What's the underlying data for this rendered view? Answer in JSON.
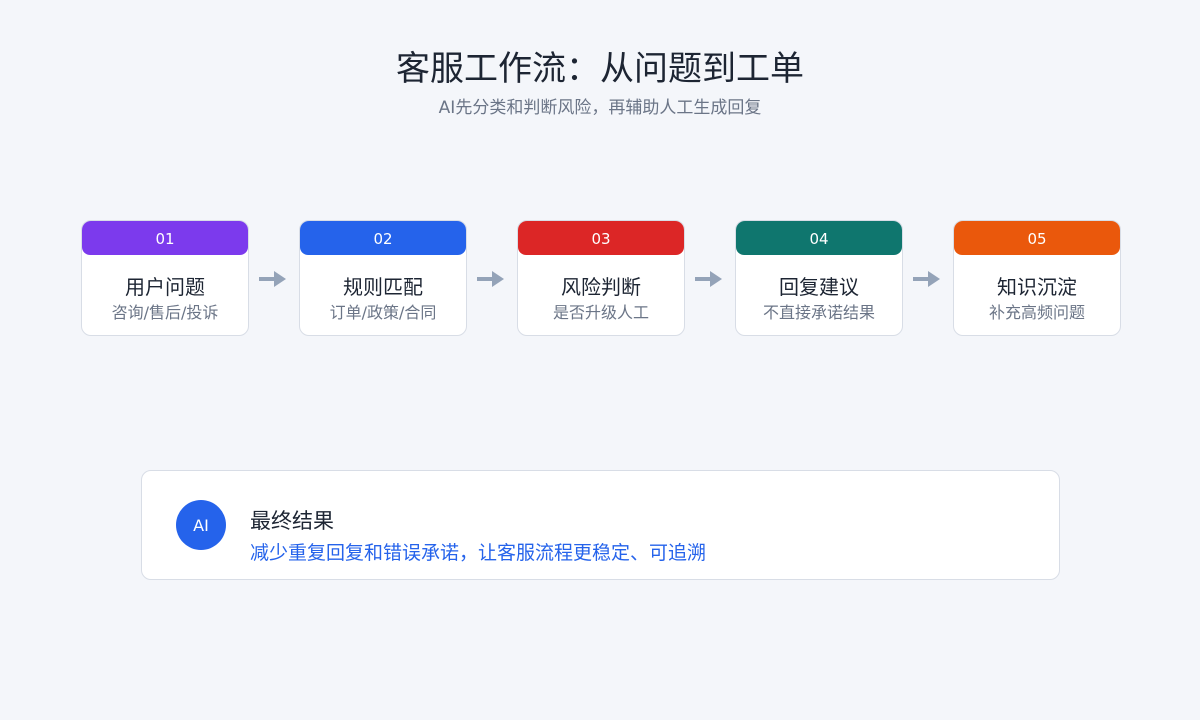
{
  "header": {
    "title": "客服工作流：从问题到工单",
    "subtitle": "AI先分类和判断风险，再辅助人工生成回复"
  },
  "steps": [
    {
      "number": "01",
      "title": "用户问题",
      "desc": "咨询/售后/投诉",
      "color": "#7c3aed"
    },
    {
      "number": "02",
      "title": "规则匹配",
      "desc": "订单/政策/合同",
      "color": "#2563eb"
    },
    {
      "number": "03",
      "title": "风险判断",
      "desc": "是否升级人工",
      "color": "#dc2626"
    },
    {
      "number": "04",
      "title": "回复建议",
      "desc": "不直接承诺结果",
      "color": "#0f766e"
    },
    {
      "number": "05",
      "title": "知识沉淀",
      "desc": "补充高频问题",
      "color": "#ea580c"
    }
  ],
  "result": {
    "badge": "AI",
    "title": "最终结果",
    "desc": "减少重复回复和错误承诺，让客服流程更稳定、可追溯"
  },
  "colors": {
    "arrow": "#94a3b8",
    "accent": "#2563eb"
  }
}
